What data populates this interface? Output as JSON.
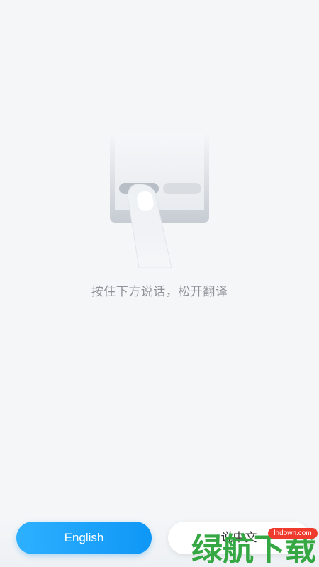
{
  "hint": {
    "text": "按住下方说话，松开翻译"
  },
  "illustration": {
    "icon": "press-to-talk-illustration"
  },
  "buttons": {
    "english_label": "English",
    "chinese_label": "说中文"
  },
  "watermark": {
    "logo_text": "绿航下载",
    "url": "lhdown.com"
  },
  "colors": {
    "background": "#f4f6f8",
    "accent": "#1a9cf8",
    "hint_text": "#8f9398",
    "watermark_green": "#35a844",
    "watermark_red": "#ef3b2d"
  }
}
